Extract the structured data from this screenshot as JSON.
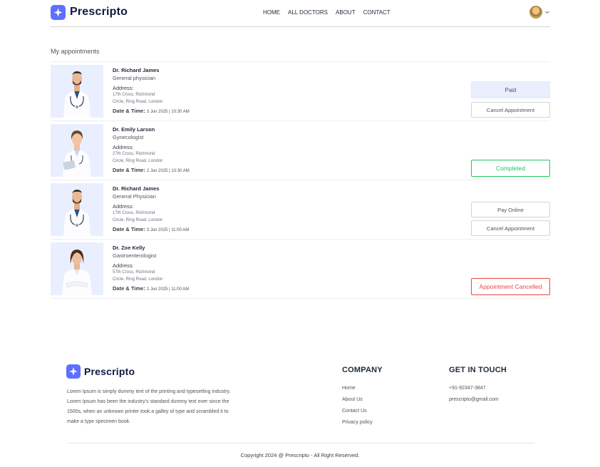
{
  "brand": {
    "name": "Prescripto",
    "accent": "#5f6fff"
  },
  "nav": {
    "links": [
      "HOME",
      "ALL DOCTORS",
      "ABOUT",
      "CONTACT"
    ],
    "profile_icon": "user-avatar",
    "dropdown_icon": "chevron-down-icon"
  },
  "page": {
    "title": "My appointments"
  },
  "labels": {
    "address": "Address:",
    "datetime": "Date & Time:"
  },
  "appointments": [
    {
      "name": "Dr. Richard James",
      "speciality": "General physician",
      "address_line1": "17th Cross, Richmond",
      "address_line2": "Circle, Ring Road, London",
      "datetime": "3 Jun 2025 | 10:30 AM",
      "buttons": [
        "Paid",
        "Cancel Appointment"
      ]
    },
    {
      "name": "Dr. Emily Larson",
      "speciality": "Gynecologist",
      "address_line1": "27th Cross, Richmond",
      "address_line2": "Circle, Ring Road, London",
      "datetime": "2 Jun 2025 | 10:30 AM",
      "buttons": [
        "Completed"
      ]
    },
    {
      "name": "Dr. Richard James",
      "speciality": "General Physician",
      "address_line1": "17th Cross, Richmond",
      "address_line2": "Circle, Ring Road, London",
      "datetime": "3 Jun 2025 | 11:00 AM",
      "buttons": [
        "Pay Online",
        "Cancel Appointment"
      ]
    },
    {
      "name": "Dr. Zoe Kelly",
      "speciality": "Gastroenterologist",
      "address_line1": "57th Cross, Richmond",
      "address_line2": "Circle, Ring Road, London",
      "datetime": "2 Jun 2025 | 11:00 AM",
      "buttons": [
        "Appointment Cancelled"
      ]
    }
  ],
  "status_colors": {
    "completed": "#22c55e",
    "cancelled": "#ef4444",
    "paid_bg": "#eaefff"
  },
  "footer": {
    "description": "Lorem Ipsum is simply dummy text of the printing and typesetting industry. Lorem Ipsum has been the industry's standard dummy text ever since the 1500s, when an unknown printer took a galley of type and scrambled it to make a type specimen book.",
    "company_heading": "COMPANY",
    "company_links": [
      "Home",
      "About Us",
      "Contact Us",
      "Privacy policy"
    ],
    "contact_heading": "GET IN TOUCH",
    "phone": "+91-92347-3847",
    "email": "prescripto@gmail.com",
    "copyright": "Copyright 2024 @ Prescripto - All Right Reserved."
  }
}
